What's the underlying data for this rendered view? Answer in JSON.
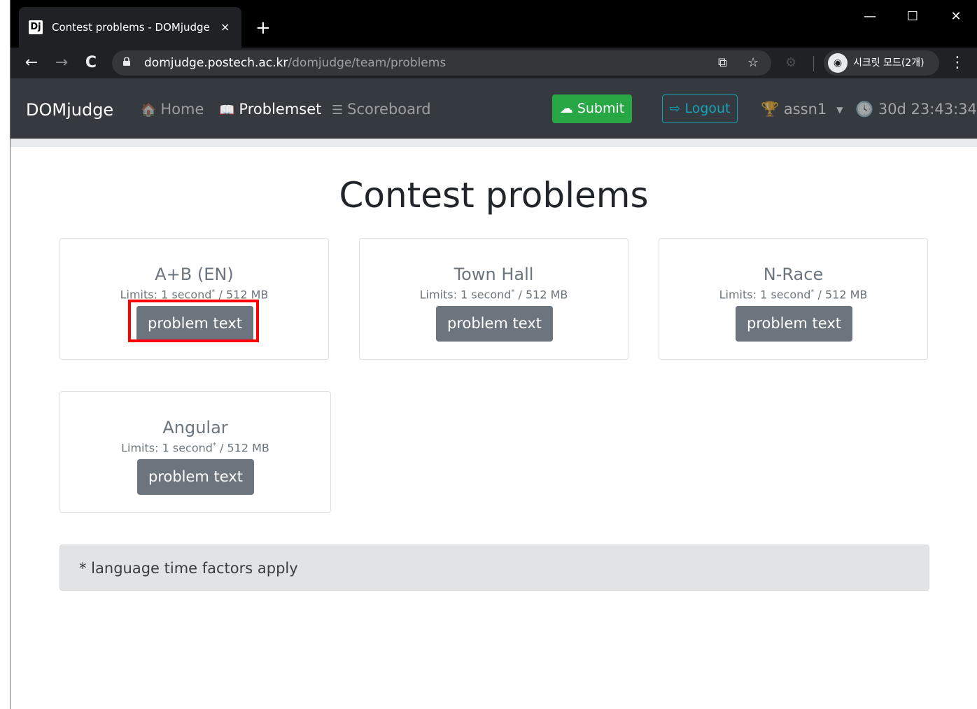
{
  "browser": {
    "tab": {
      "favicon": "Dj",
      "title": "Contest problems - DOMjudge",
      "close": "×"
    },
    "new_tab": "+",
    "window_controls": {
      "minimize": "—",
      "maximize": "☐",
      "close": "✕"
    },
    "nav": {
      "back": "←",
      "forward": "→",
      "reload": "C"
    },
    "url_host": "domjudge.postech.ac.kr",
    "url_path": "/domjudge/team/problems",
    "incognito_label": "시크릿 모드(2개)",
    "menu": "⋮"
  },
  "navbar": {
    "brand": "DOMjudge",
    "items": [
      {
        "label": "Home",
        "icon": "home-icon",
        "glyph": "🏠"
      },
      {
        "label": "Problemset",
        "icon": "book-icon",
        "glyph": "📖"
      },
      {
        "label": "Scoreboard",
        "icon": "list-icon",
        "glyph": "☰"
      }
    ],
    "submit_label": "Submit",
    "logout_label": "Logout",
    "team_name": "assn1",
    "countdown": "30d 23:43:34"
  },
  "main": {
    "title": "Contest problems",
    "problems": [
      {
        "name": "A+B (EN)",
        "limits_prefix": "Limits: 1 second",
        "limits_mark": "*",
        "limits_suffix": " / 512 MB",
        "button": "problem text"
      },
      {
        "name": "Town Hall",
        "limits_prefix": "Limits: 1 second",
        "limits_mark": "*",
        "limits_suffix": " / 512 MB",
        "button": "problem text"
      },
      {
        "name": "N-Race",
        "limits_prefix": "Limits: 1 second",
        "limits_mark": "*",
        "limits_suffix": " / 512 MB",
        "button": "problem text"
      },
      {
        "name": "Angular",
        "limits_prefix": "Limits: 1 second",
        "limits_mark": "*",
        "limits_suffix": " / 512 MB",
        "button": "problem text"
      }
    ],
    "footnote": "* language time factors apply"
  },
  "colors": {
    "navbar_bg": "#343a40",
    "submit_green": "#28a745",
    "logout_teal": "#17a2b8",
    "button_gray": "#6c757d",
    "highlight_red": "#ff0000"
  }
}
